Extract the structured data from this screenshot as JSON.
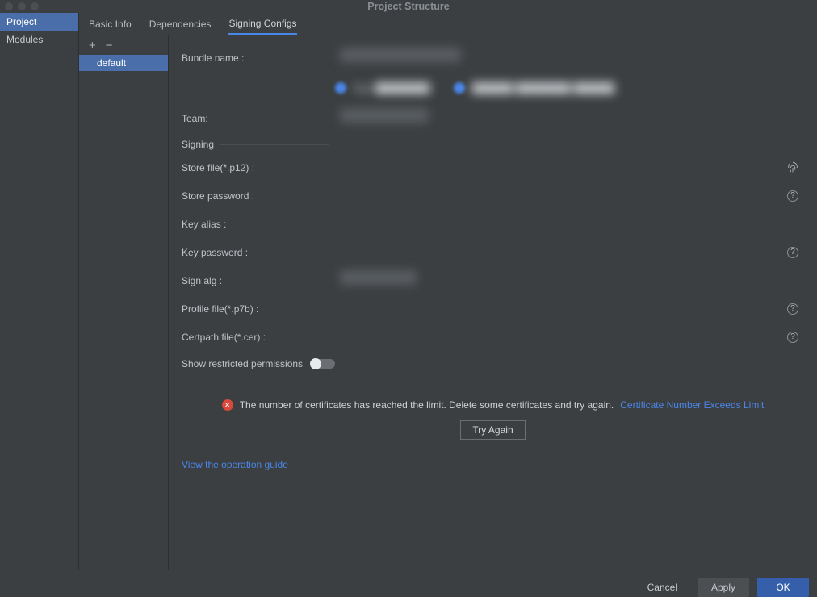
{
  "window": {
    "title": "Project Structure"
  },
  "leftRail": {
    "items": [
      {
        "label": "Project",
        "selected": true
      },
      {
        "label": "Modules",
        "selected": false
      }
    ]
  },
  "tabs": [
    {
      "label": "Basic Info",
      "active": false
    },
    {
      "label": "Dependencies",
      "active": false
    },
    {
      "label": "Signing Configs",
      "active": true
    }
  ],
  "configs": {
    "add": "+",
    "remove": "−",
    "items": [
      {
        "label": "default",
        "selected": true
      }
    ]
  },
  "form": {
    "bundle_name_label": "Bundle name :",
    "team_label": "Team:",
    "signing_legend": "Signing",
    "store_file_label": "Store file(*.p12) :",
    "store_password_label": "Store password :",
    "key_alias_label": "Key alias :",
    "key_password_label": "Key password :",
    "sign_alg_label": "Sign alg :",
    "profile_file_label": "Profile file(*.p7b) :",
    "certpath_file_label": "Certpath file(*.cer) :",
    "show_restricted_label": "Show restricted permissions",
    "bundle_name_value": "",
    "team_value": "",
    "store_file_value": "",
    "store_password_value": "",
    "key_alias_value": "",
    "key_password_value": "",
    "sign_alg_value": "",
    "profile_file_value": "",
    "certpath_file_value": "",
    "show_restricted_on": false
  },
  "error": {
    "message": "The number of certificates has reached the limit. Delete some certificates and try again.",
    "link_label": "Certificate Number Exceeds Limit",
    "retry_label": "Try Again"
  },
  "guide_link": "View the operation guide",
  "footer": {
    "cancel": "Cancel",
    "apply": "Apply",
    "ok": "OK"
  }
}
